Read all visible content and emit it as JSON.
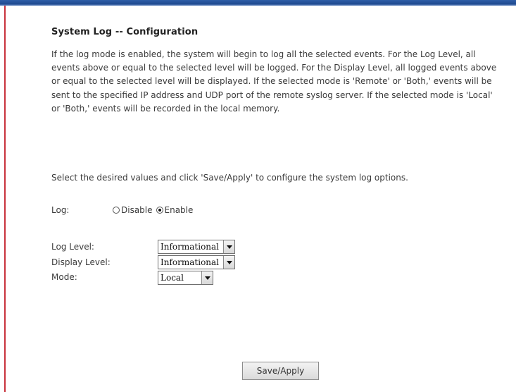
{
  "page": {
    "title": "System Log -- Configuration",
    "description": "If the log mode is enabled, the system will begin to log all the selected events. For the Log Level, all events above or equal to the selected level will be logged. For the Display Level, all logged events above or equal to the selected level will be displayed. If the selected mode is 'Remote' or 'Both,' events will be sent to the specified IP address and UDP port of the remote syslog server. If the selected mode is 'Local' or 'Both,' events will be recorded in the local memory.",
    "instruction": "Select the desired values and click 'Save/Apply' to configure the system log options."
  },
  "log": {
    "label": "Log:",
    "options": [
      {
        "label": "Disable",
        "checked": false
      },
      {
        "label": "Enable",
        "checked": true
      }
    ]
  },
  "log_level": {
    "label": "Log Level:",
    "value": "Informational"
  },
  "display_level": {
    "label": "Display Level:",
    "value": "Informational"
  },
  "mode": {
    "label": "Mode:",
    "value": "Local"
  },
  "actions": {
    "save_label": "Save/Apply"
  }
}
